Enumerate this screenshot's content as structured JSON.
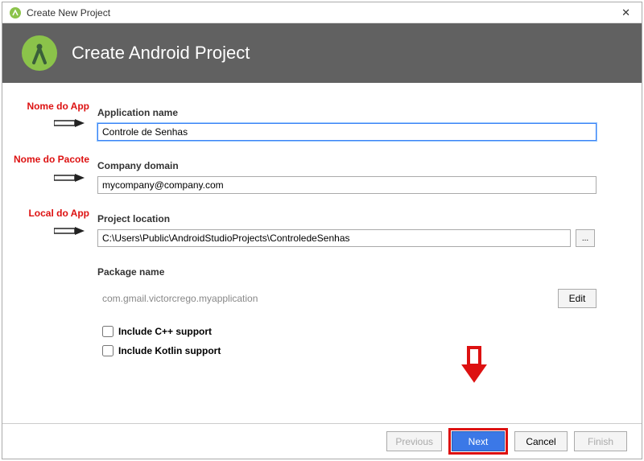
{
  "window": {
    "title": "Create New Project",
    "close_glyph": "✕"
  },
  "header": {
    "heading": "Create Android Project"
  },
  "annotations": {
    "app_name": "Nome do App",
    "package_name": "Nome do Pacote",
    "app_location": "Local do App"
  },
  "fields": {
    "application_name": {
      "label": "Application name",
      "value": "Controle de Senhas"
    },
    "company_domain": {
      "label": "Company domain",
      "value": "mycompany@company.com"
    },
    "project_location": {
      "label": "Project location",
      "value": "C:\\Users\\Public\\AndroidStudioProjects\\ControledeSenhas",
      "browse": "..."
    },
    "package_name": {
      "label": "Package name",
      "value": "com.gmail.victorcrego.myapplication",
      "edit": "Edit"
    }
  },
  "checkboxes": {
    "cpp": "Include C++ support",
    "kotlin": "Include Kotlin support"
  },
  "footer": {
    "previous": "Previous",
    "next": "Next",
    "cancel": "Cancel",
    "finish": "Finish"
  }
}
